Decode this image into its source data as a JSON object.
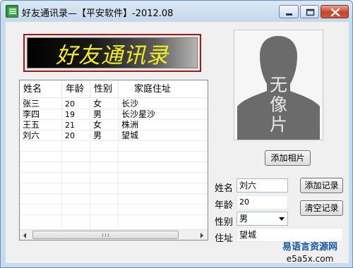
{
  "window": {
    "title": "好友通讯录—【平安软件】-2012.08"
  },
  "banner": {
    "text": "好友通讯录"
  },
  "photo": {
    "placeholder_lines": [
      "无",
      "像",
      "片"
    ]
  },
  "buttons": {
    "add_photo": "添加相片",
    "add_record": "添加记录",
    "clear_record": "清空记录"
  },
  "form": {
    "name_label": "姓名",
    "name_value": "刘六",
    "age_label": "年龄",
    "age_value": "20",
    "gender_label": "性别",
    "gender_value": "男",
    "address_label": "住址",
    "address_value": "望城"
  },
  "list": {
    "columns": [
      "姓名",
      "年龄",
      "性别",
      "家庭住址"
    ],
    "rows": [
      [
        "张三",
        "20",
        "女",
        "长沙"
      ],
      [
        "李四",
        "19",
        "男",
        "长沙星沙"
      ],
      [
        "王五",
        "21",
        "女",
        "株洲"
      ],
      [
        "刘六",
        "20",
        "男",
        "望城"
      ]
    ]
  },
  "watermark": {
    "name": "易语言资源网",
    "url": "e5a5x.com"
  },
  "colors": {
    "banner_text": "#f2ee20",
    "banner_border": "#9b1c1c",
    "watermark": "#1657a8"
  },
  "icons": [
    "app-icon",
    "minimize-icon",
    "maximize-icon",
    "close-icon",
    "person-silhouette-icon"
  ]
}
